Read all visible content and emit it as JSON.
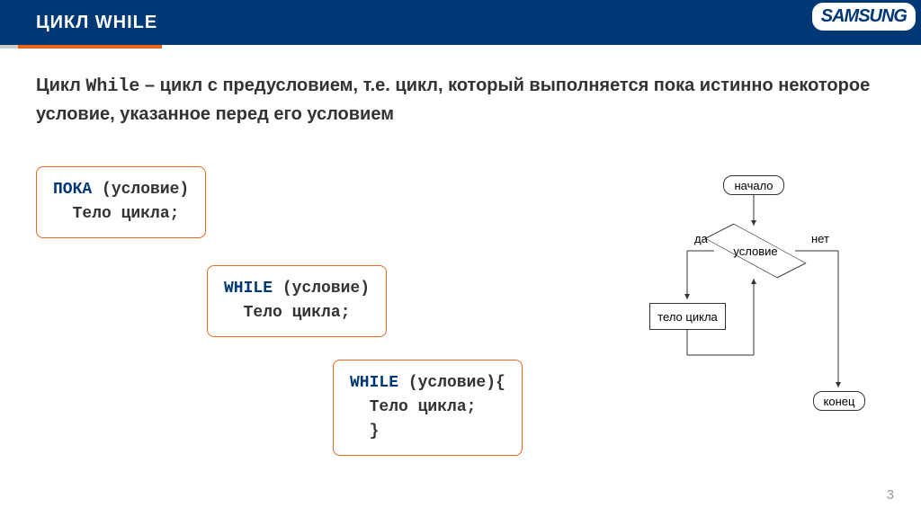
{
  "header": {
    "title": "ЦИКЛ WHILE",
    "brand": "SAMSUNG"
  },
  "description": {
    "prefix": "Цикл ",
    "keyword": "While",
    "rest": " – цикл с предусловием, т.е. цикл, который выполняется пока истинно некоторое условие, указанное перед его условием"
  },
  "codeboxes": {
    "box1": {
      "line1_kw": "ПОКА",
      "line1_cond": " (условие)",
      "line2": "  Тело цикла;"
    },
    "box2": {
      "line1_kw": "WHILE",
      "line1_cond": " (условие)",
      "line2": "  Тело цикла;"
    },
    "box3": {
      "line1_kw": "WHILE",
      "line1_cond": " (условие){",
      "line2": "  Тело цикла;",
      "line3": "  }"
    }
  },
  "flowchart": {
    "start": "начало",
    "condition": "условие",
    "body": "тело цикла",
    "end": "конец",
    "yes": "да",
    "no": "нет"
  },
  "page": "3"
}
